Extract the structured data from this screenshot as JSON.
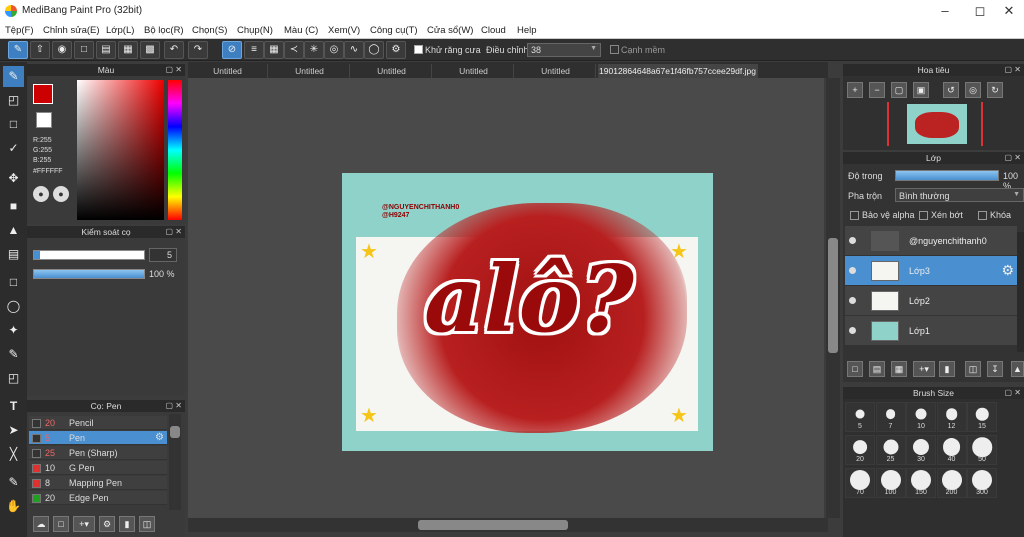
{
  "app": {
    "title": "MediBang Paint Pro (32bit)"
  },
  "menu": [
    "Tệp(F)",
    "Chỉnh sửa(E)",
    "Lớp(L)",
    "Bộ lọc(R)",
    "Chọn(S)",
    "Chụp(N)",
    "Màu (C)",
    "Xem(V)",
    "Công cụ(T)",
    "Cửa sổ(W)",
    "Cloud",
    "Help"
  ],
  "toolbar": {
    "antialias_label": "Khử răng cưa",
    "adjust_label": "Điều chỉnh",
    "adjust_value": "38",
    "edge_label": "Cạnh mềm"
  },
  "color_panel": {
    "title": "Màu",
    "r": "R:255",
    "g": "G:255",
    "b": "B:255",
    "hex": "#FFFFFF",
    "fg": "#c00000",
    "bg": "#ffffff"
  },
  "brush_control": {
    "title": "Kiểm soát cọ",
    "size": "5",
    "opacity": "100 %",
    "opacity_fraction": 1.0
  },
  "brush_panel": {
    "title": "Cọ: Pen",
    "items": [
      {
        "size": "20",
        "name": "Pencil",
        "color": "#333333"
      },
      {
        "size": "5",
        "name": "Pen",
        "color": "#333333",
        "selected": true
      },
      {
        "size": "25",
        "name": "Pen (Sharp)",
        "color": "#333333"
      },
      {
        "size": "10",
        "name": "G Pen",
        "color": "#e03030"
      },
      {
        "size": "8",
        "name": "Mapping Pen",
        "color": "#e03030"
      },
      {
        "size": "20",
        "name": "Edge Pen",
        "color": "#20a020"
      }
    ]
  },
  "tabs": [
    "Untitled",
    "Untitled",
    "Untitled",
    "Untitled",
    "Untitled",
    "19012864648a67e1f46fb757ccee29df.jpg"
  ],
  "artwork": {
    "credit1": "@NGUYENCHITHANH0",
    "credit2": "@H9247",
    "main_text": "alô?"
  },
  "navigator": {
    "title": "Hoa tiêu"
  },
  "layer_panel": {
    "title": "Lớp",
    "opacity_label": "Độ trong",
    "opacity_value": "100 %",
    "blend_label": "Pha trộn",
    "blend_value": "Bình thường",
    "protect_alpha": "Bảo vệ alpha",
    "clipping": "Xén bớt",
    "lock": "Khóa",
    "layers": [
      {
        "name": "@nguyenchithanh0",
        "selected": false
      },
      {
        "name": "Lớp3",
        "selected": true
      },
      {
        "name": "Lớp2",
        "selected": false
      },
      {
        "name": "Lớp1",
        "selected": false
      }
    ]
  },
  "brush_size_panel": {
    "title": "Brush Size",
    "sizes": [
      "5",
      "7",
      "10",
      "12",
      "15",
      "20",
      "25",
      "30",
      "40",
      "50",
      "70",
      "100",
      "150",
      "200",
      "300"
    ]
  }
}
